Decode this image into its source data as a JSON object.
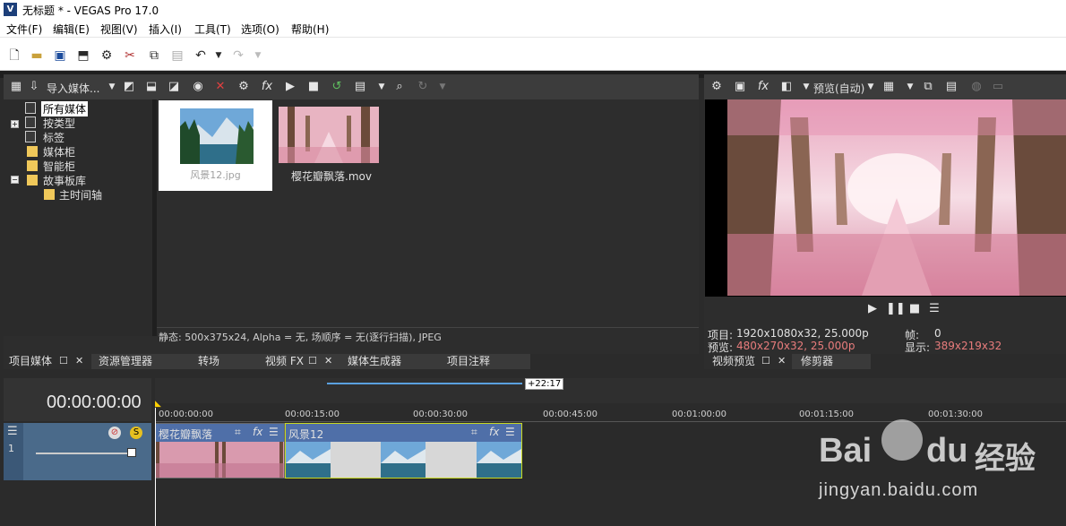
{
  "window": {
    "title": "无标题 * - VEGAS Pro 17.0",
    "logo_letter": "V"
  },
  "menu": [
    "文件(F)",
    "编辑(E)",
    "视图(V)",
    "插入(I)",
    "工具(T)",
    "选项(O)",
    "帮助(H)"
  ],
  "media_panel": {
    "import_label": "导入媒体...",
    "tree": [
      {
        "label": "所有媒体",
        "selected": true
      },
      {
        "label": "按类型"
      },
      {
        "label": "标签"
      },
      {
        "label": "媒体柜"
      },
      {
        "label": "智能柜"
      },
      {
        "label": "故事板库"
      },
      {
        "label": "主时间轴"
      }
    ],
    "thumbnails": [
      {
        "label": "风景12.jpg",
        "selected": true
      },
      {
        "label": "樱花瓣飘落.mov",
        "selected": false
      }
    ],
    "status": "静态: 500x375x24, Alpha = 无, 场顺序 = 无(逐行扫描), JPEG"
  },
  "dock_tabs": [
    "项目媒体",
    "资源管理器",
    "转场",
    "视频 FX",
    "媒体生成器",
    "项目注释"
  ],
  "preview": {
    "mode_label": "预览(自动)",
    "project_label": "项目:",
    "project_value": "1920x1080x32, 25.000p",
    "preview_label": "预览:",
    "preview_value": "480x270x32, 25.000p",
    "frame_label": "帧:",
    "frame_value": "0",
    "display_label": "显示:",
    "display_value": "389x219x32",
    "tabs": [
      "视频预览",
      "修剪器"
    ],
    "accent_color": "#e87c7c"
  },
  "timeline": {
    "timecode": "00:00:00:00",
    "loop_label": "+22:17",
    "ruler": [
      "00:00:00:00",
      "00:00:15:00",
      "00:00:30:00",
      "00:00:45:00",
      "00:01:00:00",
      "00:01:15:00",
      "00:01:30:00"
    ],
    "track_number": "1",
    "clips": [
      {
        "name": "樱花瓣飘落"
      },
      {
        "name": "风景12"
      }
    ]
  },
  "watermark": {
    "brand": "Bai",
    "brand2": "du",
    "cn": "经验",
    "url": "jingyan.baidu.com"
  }
}
